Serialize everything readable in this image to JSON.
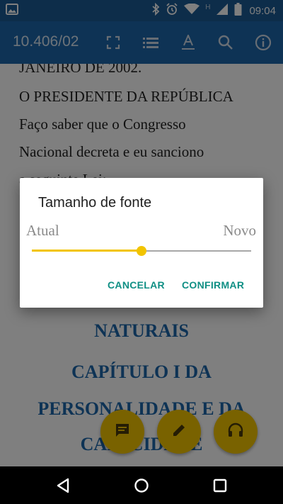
{
  "status_bar": {
    "time": "09:04",
    "network_label": "H",
    "icons": [
      "image-icon",
      "bluetooth-icon",
      "alarm-icon",
      "wifi-icon",
      "signal-icon",
      "battery-icon"
    ]
  },
  "app_bar": {
    "title": "10.406/02",
    "icons": [
      "fullscreen-icon",
      "list-icon",
      "text-format-icon",
      "search-icon",
      "info-icon"
    ]
  },
  "document": {
    "lines": [
      "JANEIRO DE 2002.",
      "O PRESIDENTE DA REPÚBLICA",
      "Faço saber que o Congresso",
      "Nacional decreta e eu sanciono",
      "a seguinte Lei:"
    ],
    "headings": [
      "NATURAIS",
      "CAPÍTULO I DA",
      "PERSONALIDADE E DA",
      "CAPACIDADE"
    ]
  },
  "fabs": [
    "comment-icon",
    "edit-icon",
    "headphones-icon"
  ],
  "dialog": {
    "title": "Tamanho de fonte",
    "label_current": "Atual",
    "label_new": "Novo",
    "slider_value": 0.5,
    "cancel_label": "CANCELAR",
    "confirm_label": "CONFIRMAR"
  },
  "colors": {
    "primary": "#1d67ab",
    "status_bar": "#1a5a94",
    "accent": "#f2c400",
    "dialog_button": "#0f8f84"
  },
  "nav_bar": {
    "icons": [
      "back-icon",
      "home-icon",
      "recents-icon"
    ]
  }
}
